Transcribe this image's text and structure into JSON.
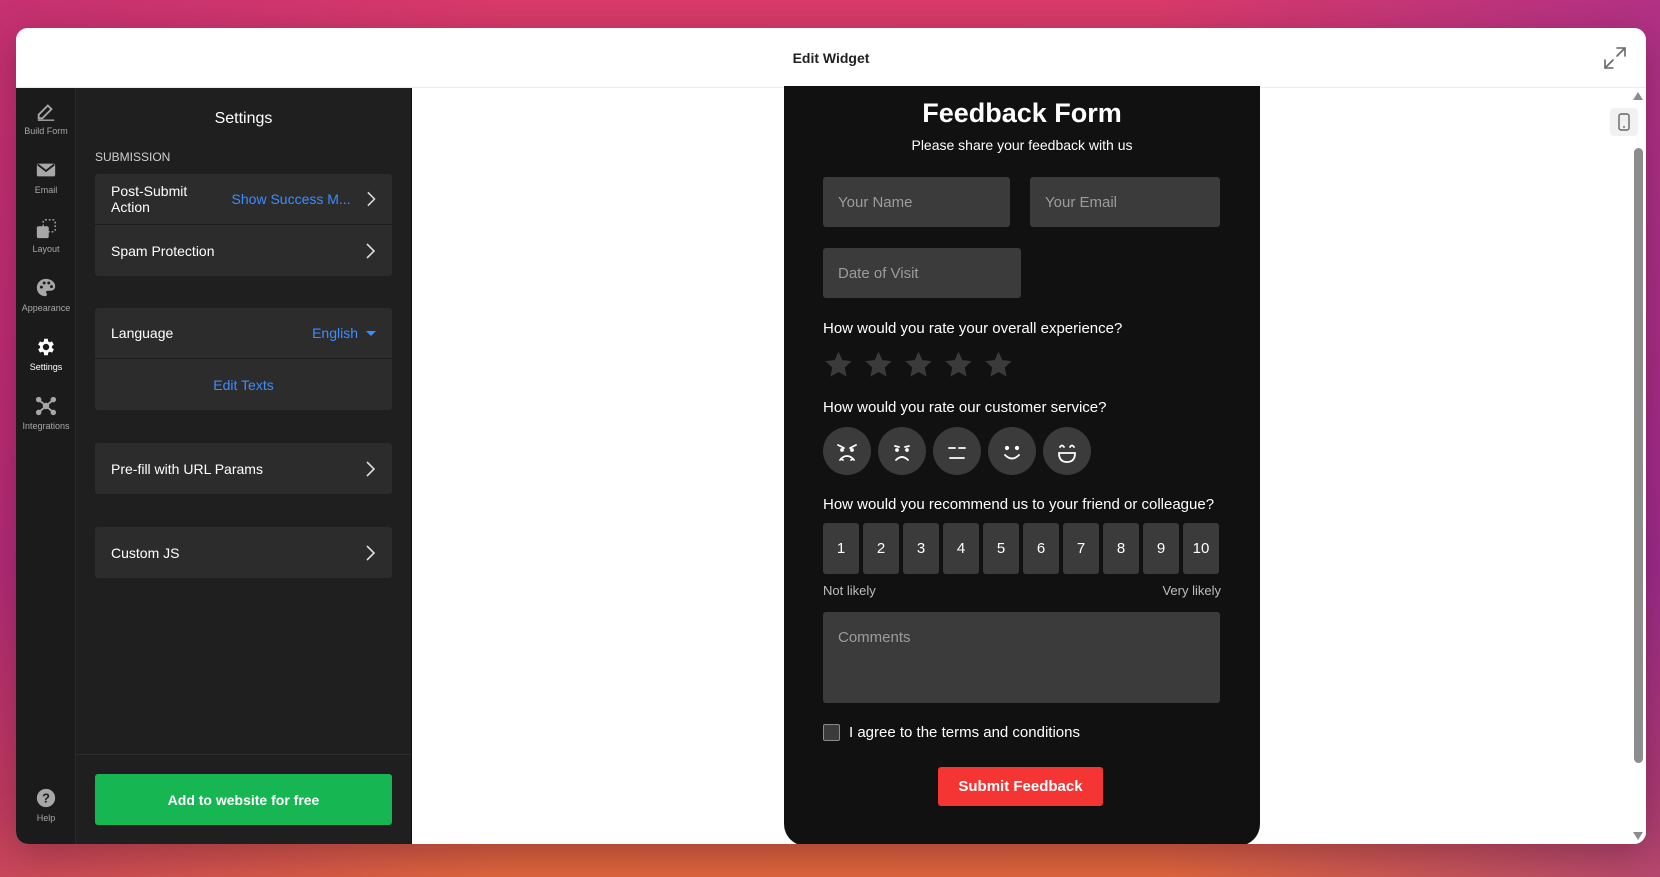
{
  "window": {
    "title": "Edit Widget"
  },
  "iconbar": {
    "items": [
      {
        "label": "Build Form",
        "icon": "pencil-icon"
      },
      {
        "label": "Email",
        "icon": "mail-icon"
      },
      {
        "label": "Layout",
        "icon": "layout-icon"
      },
      {
        "label": "Appearance",
        "icon": "palette-icon"
      },
      {
        "label": "Settings",
        "icon": "gear-icon",
        "active": true
      },
      {
        "label": "Integrations",
        "icon": "integrations-icon"
      }
    ],
    "help": "Help"
  },
  "settings": {
    "heading": "Settings",
    "submission_label": "SUBMISSION",
    "post_submit": {
      "label": "Post-Submit Action",
      "value": "Show Success M..."
    },
    "spam": {
      "label": "Spam Protection"
    },
    "language": {
      "label": "Language",
      "value": "English",
      "edit_texts": "Edit Texts"
    },
    "prefill": {
      "label": "Pre-fill with URL Params"
    },
    "custom_js": {
      "label": "Custom JS"
    },
    "add_button": "Add to website for free"
  },
  "form": {
    "title": "Feedback Form",
    "subtitle": "Please share your feedback with us",
    "name_placeholder": "Your Name",
    "email_placeholder": "Your Email",
    "date_placeholder": "Date of Visit",
    "q1": "How would you rate your overall experience?",
    "stars_rating": 0,
    "stars_max": 5,
    "q2": "How would you rate our customer service?",
    "q3": "How would you recommend us to your friend or colleague?",
    "nps": [
      "1",
      "2",
      "3",
      "4",
      "5",
      "6",
      "7",
      "8",
      "9",
      "10"
    ],
    "nps_low": "Not likely",
    "nps_high": "Very likely",
    "comments_placeholder": "Comments",
    "agree": "I agree to the terms and conditions",
    "submit": "Submit Feedback"
  },
  "colors": {
    "accent_blue": "#3b8dff",
    "green": "#16b653",
    "submit_red": "#f53434"
  }
}
